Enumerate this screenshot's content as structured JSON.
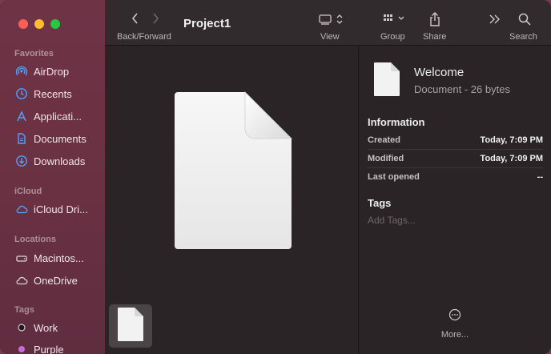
{
  "window": {
    "title": "Project1"
  },
  "toolbar": {
    "nav_label": "Back/Forward",
    "view_label": "View",
    "group_label": "Group",
    "share_label": "Share",
    "search_label": "Search"
  },
  "sidebar": {
    "favorites_label": "Favorites",
    "favorites": [
      {
        "label": "AirDrop",
        "icon": "airdrop-icon"
      },
      {
        "label": "Recents",
        "icon": "clock-icon"
      },
      {
        "label": "Applicati...",
        "icon": "applications-icon"
      },
      {
        "label": "Documents",
        "icon": "document-icon"
      },
      {
        "label": "Downloads",
        "icon": "download-icon"
      }
    ],
    "icloud_label": "iCloud",
    "icloud": [
      {
        "label": "iCloud Dri...",
        "icon": "cloud-icon"
      }
    ],
    "locations_label": "Locations",
    "locations": [
      {
        "label": "Macintos...",
        "icon": "disk-icon"
      },
      {
        "label": "OneDrive",
        "icon": "cloud-icon"
      }
    ],
    "tags_label": "Tags",
    "tags": [
      {
        "label": "Work",
        "color": "#1e1a1b"
      },
      {
        "label": "Purple",
        "color": "#c86bd8"
      }
    ]
  },
  "inspector": {
    "name": "Welcome",
    "kind": "Document - 26 bytes",
    "info_heading": "Information",
    "rows": [
      {
        "key": "Created",
        "value": "Today, 7:09 PM"
      },
      {
        "key": "Modified",
        "value": "Today, 7:09 PM"
      },
      {
        "key": "Last opened",
        "value": "--"
      }
    ],
    "tags_heading": "Tags",
    "tags_placeholder": "Add Tags...",
    "more_label": "More..."
  },
  "colors": {
    "sidebar_accent": "#4fa3ff",
    "window_bg": "#2a2426",
    "sidebar_bg": "#6f3346"
  }
}
